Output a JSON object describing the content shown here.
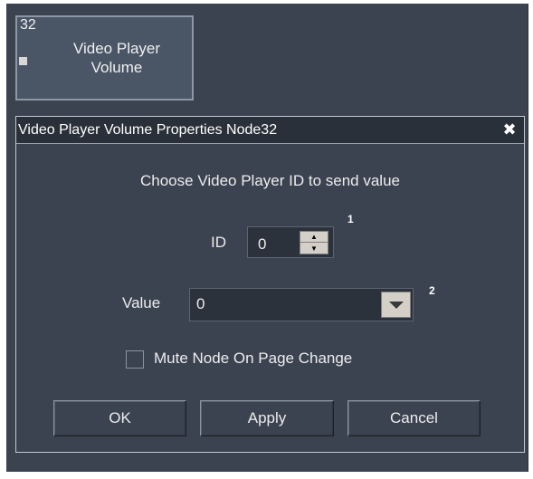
{
  "node": {
    "id": "32",
    "title_line1": "Video Player",
    "title_line2": "Volume"
  },
  "dialog": {
    "title": "Video Player Volume Properties Node32",
    "close_glyph": "✖",
    "prompt": "Choose Video Player ID to send value",
    "id_field": {
      "label": "ID",
      "value": "0",
      "note": "1"
    },
    "value_field": {
      "label": "Value",
      "selected": "0",
      "note": "2"
    },
    "mute_checkbox": {
      "label": "Mute Node On Page Change",
      "checked": false
    },
    "buttons": {
      "ok": "OK",
      "apply": "Apply",
      "cancel": "Cancel"
    }
  },
  "icons": {
    "spin_up": "up-arrow-icon",
    "spin_down": "down-arrow-icon",
    "dropdown": "chevron-down-icon",
    "close": "close-icon"
  },
  "colors": {
    "background": "#3b4351",
    "titlebar": "#2a3039",
    "node_fill": "#4a5566",
    "node_border": "#8d97a6",
    "text": "#ececec"
  }
}
